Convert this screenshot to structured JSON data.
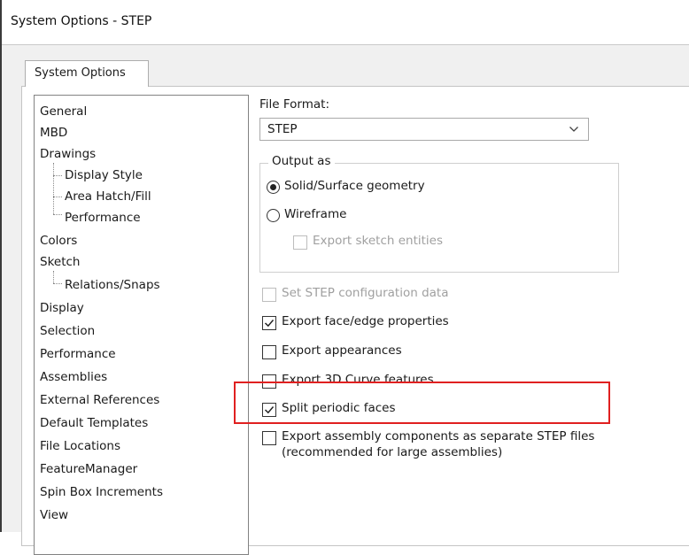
{
  "window": {
    "title": "System Options - STEP"
  },
  "tabs": [
    {
      "label": "System Options"
    }
  ],
  "nav": {
    "items": [
      {
        "label": "General"
      },
      {
        "label": "MBD"
      },
      {
        "label": "Drawings"
      },
      {
        "label": "Display Style"
      },
      {
        "label": "Area Hatch/Fill"
      },
      {
        "label": "Performance"
      },
      {
        "label": "Colors"
      },
      {
        "label": "Sketch"
      },
      {
        "label": "Relations/Snaps"
      },
      {
        "label": "Display"
      },
      {
        "label": "Selection"
      },
      {
        "label": "Performance"
      },
      {
        "label": "Assemblies"
      },
      {
        "label": "External References"
      },
      {
        "label": "Default Templates"
      },
      {
        "label": "File Locations"
      },
      {
        "label": "FeatureManager"
      },
      {
        "label": "Spin Box Increments"
      },
      {
        "label": "View"
      }
    ]
  },
  "options": {
    "file_format_label": "File Format:",
    "file_format_value": "STEP",
    "output_as_label": "Output as",
    "output_options": [
      {
        "label": "Solid/Surface geometry",
        "selected": true
      },
      {
        "label": "Wireframe",
        "selected": false
      }
    ],
    "export_sketch_entities": {
      "label": "Export sketch entities",
      "checked": false,
      "enabled": false
    },
    "set_step_config": {
      "label": "Set STEP configuration data",
      "checked": false,
      "enabled": false
    },
    "export_face_edge": {
      "label": "Export face/edge properties",
      "checked": true
    },
    "export_appearances": {
      "label": "Export appearances",
      "checked": false
    },
    "export_3d_curve": {
      "label": "Export 3D Curve features",
      "checked": false
    },
    "split_periodic": {
      "label": "Split periodic faces",
      "checked": true
    },
    "export_assembly_components": {
      "label_line1": "Export assembly components as separate STEP files",
      "label_line2": "(recommended for large assemblies)",
      "checked": false
    }
  },
  "colors": {
    "highlight": "#e02020"
  }
}
